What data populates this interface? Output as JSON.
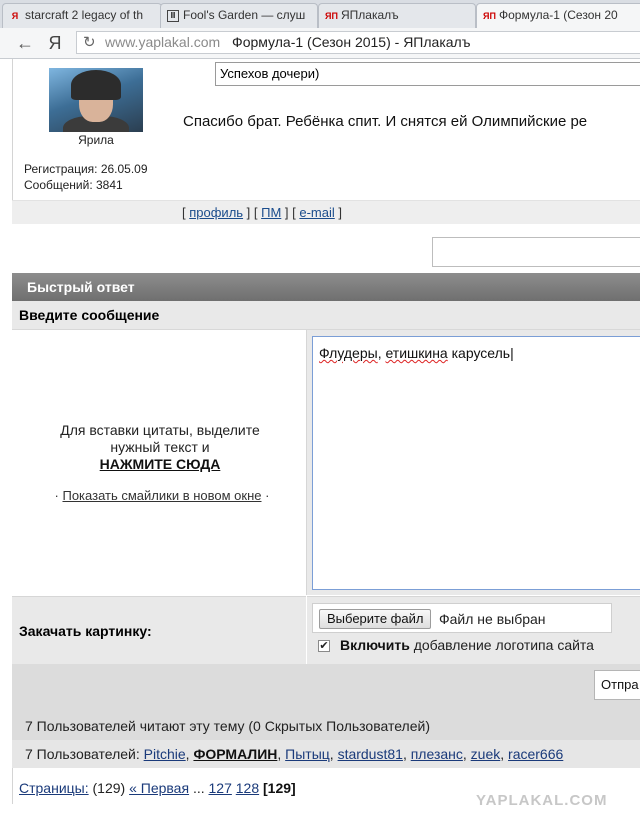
{
  "tabs": [
    {
      "favicon": "Я",
      "label": "starcraft 2 legacy of th"
    },
    {
      "favicon": "II",
      "label": "Fool's Garden — слуш"
    },
    {
      "favicon": "ЯП",
      "label": "ЯПлакалъ"
    },
    {
      "favicon": "ЯП",
      "label": "Формула-1 (Сезон 20"
    }
  ],
  "address": {
    "back_icon": "←",
    "yandex_icon": "Я",
    "reload_icon": "↻",
    "host": "www.yaplakal.com",
    "page_title": "Формула-1 (Сезон 2015) - ЯПлакалъ"
  },
  "post": {
    "username": "Ярила",
    "registration": "Регистрация: 26.05.09",
    "messages": "Сообщений: 3841",
    "quote_title": "Успехов дочери)",
    "text": "Спасибо брат. Ребёнка спит. И снятся ей Олимпийские ре",
    "links": {
      "open1": "[ ",
      "profile": "профиль",
      "sep1": " ] [ ",
      "pm": "ПМ",
      "sep2": " ] [ ",
      "email": "e-mail",
      "close": " ]"
    }
  },
  "quick_reply": {
    "header": "Быстрый ответ",
    "enter_message": "Введите сообщение",
    "hint_line1": "Для вставки цитаты, выделите",
    "hint_line2": "нужный текст и",
    "hint_click": "НАЖМИТЕ СЮДА",
    "smiles_prefix": "· ",
    "smiles_link": "Показать смайлики в новом окне",
    "smiles_suffix": " ·",
    "message_text_1": "Флудеры",
    "message_text_2": ", ",
    "message_text_3": "етишкина",
    "message_text_4": " карусель",
    "upload_label": "Закачать картинку:",
    "file_button": "Выберите файл",
    "file_status": "Файл не выбран",
    "checkbox_mark": "✔",
    "checkbox_bold": "Включить",
    "checkbox_rest": " добавление логотипа сайта",
    "send_button": "Отпра"
  },
  "readers": {
    "summary": "7 Пользователей читают эту тему (0 Скрытых Пользователей)",
    "users_prefix": "7 Пользователей: ",
    "users": [
      "Pitchie",
      "ФОРМАЛИН",
      "Пытыц",
      "stardust81",
      "плезанс",
      "zuek",
      "racer666"
    ],
    "sep": ", "
  },
  "pagination": {
    "label": "Страницы:",
    "count": " (129) ",
    "first": "« Первая",
    "ellipsis": " ... ",
    "p127": "127",
    "p128": "128",
    "current": "[129]"
  },
  "watermark": "YAPLAKAL.COM"
}
